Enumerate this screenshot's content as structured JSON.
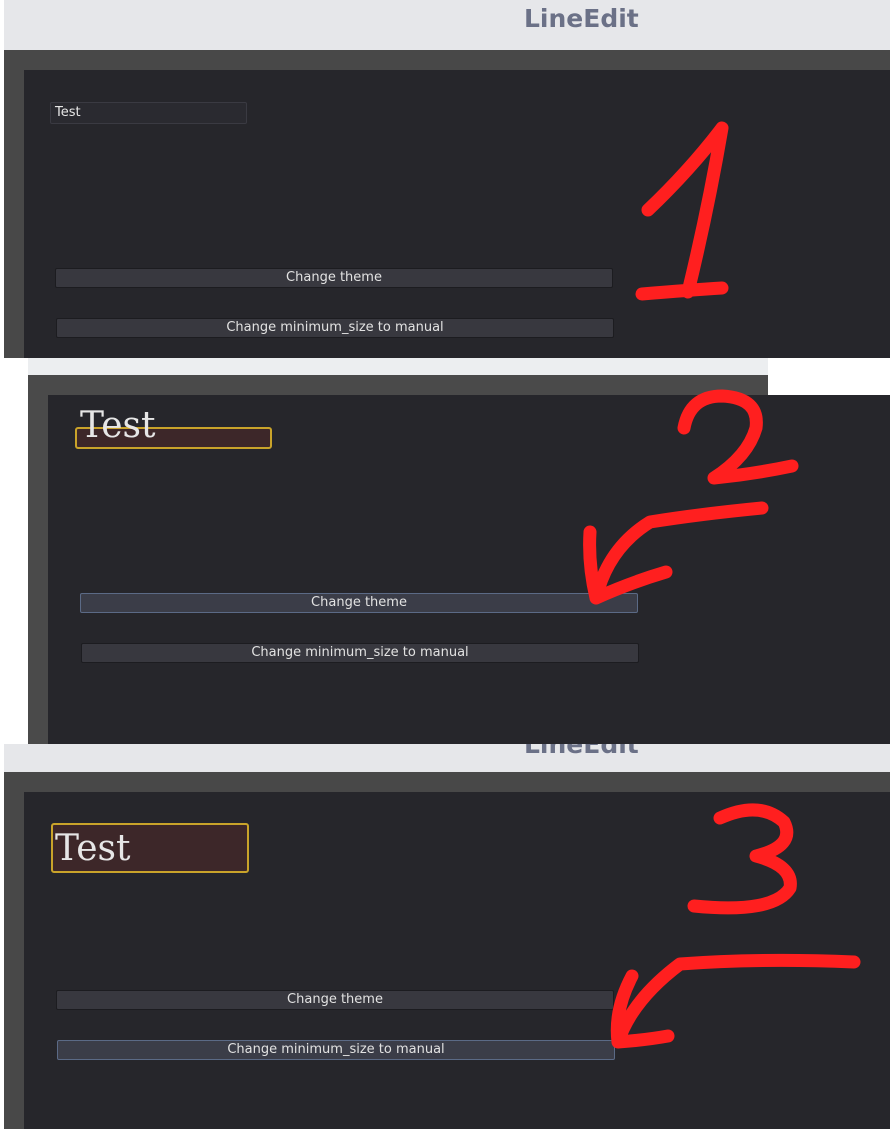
{
  "window": {
    "title": "LineEdit"
  },
  "panels": [
    {
      "line_edit_text": "Test",
      "buttons": [
        "Change theme",
        "Change minimum_size to manual"
      ]
    },
    {
      "line_edit_text": "Test",
      "buttons": [
        "Change theme",
        "Change minimum_size to manual"
      ]
    },
    {
      "line_edit_text": "Test",
      "buttons": [
        "Change theme",
        "Change minimum_size to manual"
      ]
    }
  ],
  "annotations": {
    "numbers": [
      "1",
      "2",
      "3"
    ],
    "color": "#ff1f1f"
  },
  "colors": {
    "panel_bg": "#26262b",
    "focus_border": "#c9a32a",
    "focus_fill": "#3d2729",
    "title_text": "#6b7187"
  }
}
